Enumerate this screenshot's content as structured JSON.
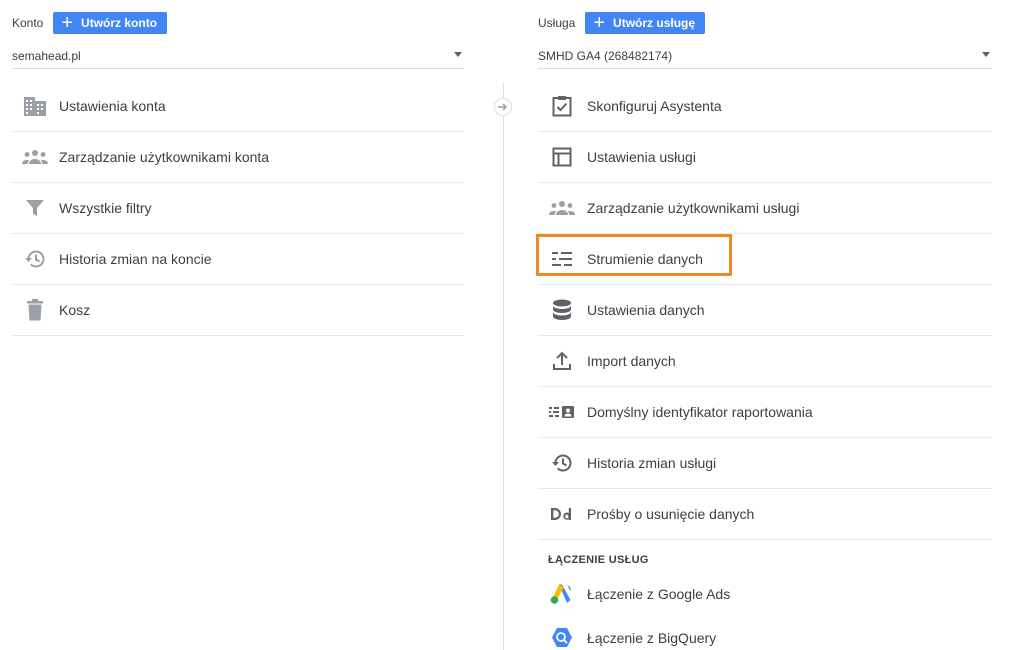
{
  "account": {
    "label": "Konto",
    "create_button": "Utwórz konto",
    "selected": "semahead.pl",
    "items": [
      {
        "label": "Ustawienia konta",
        "icon": "building-icon"
      },
      {
        "label": "Zarządzanie użytkownikami konta",
        "icon": "people-icon"
      },
      {
        "label": "Wszystkie filtry",
        "icon": "filter-icon"
      },
      {
        "label": "Historia zmian na koncie",
        "icon": "history-icon"
      },
      {
        "label": "Kosz",
        "icon": "trash-icon"
      }
    ]
  },
  "property": {
    "label": "Usługa",
    "create_button": "Utwórz usługę",
    "selected": "SMHD GA4 (268482174)",
    "items": [
      {
        "label": "Skonfiguruj Asystenta",
        "icon": "clipboard-check-icon"
      },
      {
        "label": "Ustawienia usługi",
        "icon": "layout-icon"
      },
      {
        "label": "Zarządzanie użytkownikami usługi",
        "icon": "people-icon"
      },
      {
        "label": "Strumienie danych",
        "icon": "data-streams-icon",
        "highlighted": true
      },
      {
        "label": "Ustawienia danych",
        "icon": "database-icon"
      },
      {
        "label": "Import danych",
        "icon": "upload-icon"
      },
      {
        "label": "Domyślny identyfikator raportowania",
        "icon": "reporting-identity-icon"
      },
      {
        "label": "Historia zmian usługi",
        "icon": "history-icon"
      },
      {
        "label": "Prośby o usunięcie danych",
        "icon": "dd-icon"
      }
    ],
    "linking_section": {
      "title": "ŁĄCZENIE USŁUG",
      "items": [
        {
          "label": "Łączenie z Google Ads",
          "icon": "google-ads-icon"
        },
        {
          "label": "Łączenie z BigQuery",
          "icon": "bigquery-icon"
        }
      ]
    }
  },
  "colors": {
    "primary_button": "#4285f4",
    "highlight": "#f08a24",
    "icon_grey": "#5f6368"
  }
}
